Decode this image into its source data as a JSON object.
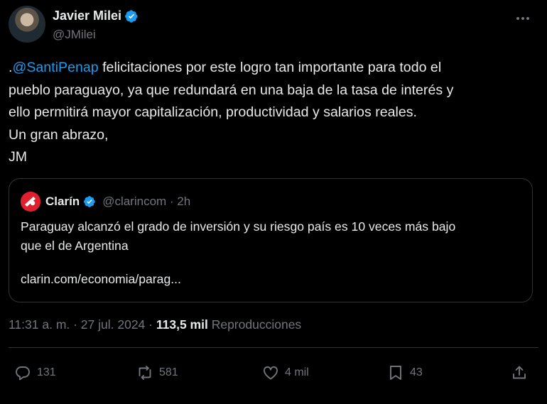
{
  "author": {
    "display_name": "Javier Milei",
    "handle": "@JMilei",
    "verified": true
  },
  "tweet": {
    "lines": [
      [
        ".",
        "@SantiPenap",
        " felicitaciones por este logro tan importante para todo el"
      ],
      "pueblo paraguayo, ya que redundará en una baja de la tasa de interés y",
      "ello permitirá mayor capitalización, productividad y salarios reales.",
      "Un gran abrazo,",
      "JM"
    ]
  },
  "quote": {
    "display_name": "Clarín",
    "handle_time": "@clarincom · 2h",
    "text_lines": [
      "Paraguay alcanzó el grado de inversión y su riesgo país es 10 veces más bajo",
      "que el de Argentina"
    ],
    "link": "clarin.com/economia/parag..."
  },
  "meta": {
    "time_date": "11:31 a. m. · 27 jul. 2024 · ",
    "views": "113,5 mil",
    "views_label": " Reproducciones"
  },
  "actions": {
    "replies": "131",
    "reposts": "581",
    "likes": "4 mil",
    "bookmarks": "43"
  },
  "colors": {
    "background": "#000000",
    "text": "#e7e9ea",
    "secondary": "#71767b",
    "accent": "#1d9bf0",
    "border": "#2f3336",
    "clarin_red": "#e0202e"
  },
  "icons": [
    "verified-badge-icon",
    "more-icon",
    "clarin-logo",
    "reply-icon",
    "repost-icon",
    "like-icon",
    "bookmark-icon",
    "share-icon"
  ]
}
